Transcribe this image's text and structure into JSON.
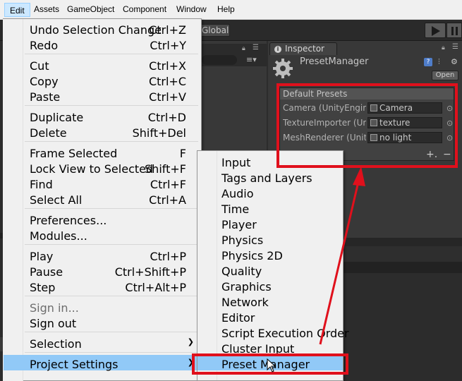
{
  "menubar": {
    "items": [
      "Edit",
      "Assets",
      "GameObject",
      "Component",
      "Window",
      "Help"
    ]
  },
  "toolbar": {
    "global_label": "Global"
  },
  "inspector": {
    "tab_label": "Inspector",
    "title": "PresetManager",
    "open_button": "Open",
    "section_header": "Default Presets",
    "rows": [
      {
        "label": "Camera (UnityEngine",
        "value": "Camera"
      },
      {
        "label": "TextureImporter (Un",
        "value": "texture"
      },
      {
        "label": "MeshRenderer (Unity",
        "value": "no light"
      }
    ],
    "add_label": "+.",
    "remove_label": "−"
  },
  "edit_menu": {
    "items": [
      {
        "label": "Undo Selection Change",
        "shortcut": "Ctrl+Z"
      },
      {
        "label": "Redo",
        "shortcut": "Ctrl+Y"
      },
      {
        "label": "Cut",
        "shortcut": "Ctrl+X"
      },
      {
        "label": "Copy",
        "shortcut": "Ctrl+C"
      },
      {
        "label": "Paste",
        "shortcut": "Ctrl+V"
      },
      {
        "label": "Duplicate",
        "shortcut": "Ctrl+D"
      },
      {
        "label": "Delete",
        "shortcut": "Shift+Del"
      },
      {
        "label": "Frame Selected",
        "shortcut": "F"
      },
      {
        "label": "Lock View to Selected",
        "shortcut": "Shift+F"
      },
      {
        "label": "Find",
        "shortcut": "Ctrl+F"
      },
      {
        "label": "Select All",
        "shortcut": "Ctrl+A"
      },
      {
        "label": "Preferences...",
        "shortcut": ""
      },
      {
        "label": "Modules...",
        "shortcut": ""
      },
      {
        "label": "Play",
        "shortcut": "Ctrl+P"
      },
      {
        "label": "Pause",
        "shortcut": "Ctrl+Shift+P"
      },
      {
        "label": "Step",
        "shortcut": "Ctrl+Alt+P"
      },
      {
        "label": "Sign in...",
        "shortcut": ""
      },
      {
        "label": "Sign out",
        "shortcut": ""
      },
      {
        "label": "Selection",
        "shortcut": ""
      },
      {
        "label": "Project Settings",
        "shortcut": ""
      }
    ]
  },
  "project_settings_menu": {
    "items": [
      "Input",
      "Tags and Layers",
      "Audio",
      "Time",
      "Player",
      "Physics",
      "Physics 2D",
      "Quality",
      "Graphics",
      "Network",
      "Editor",
      "Script Execution Order",
      "Cluster Input",
      "Preset Manager"
    ]
  },
  "colors": {
    "menu_highlight": "#91c9f7",
    "annotation_red": "#e0101c",
    "editor_dark": "#383838"
  }
}
